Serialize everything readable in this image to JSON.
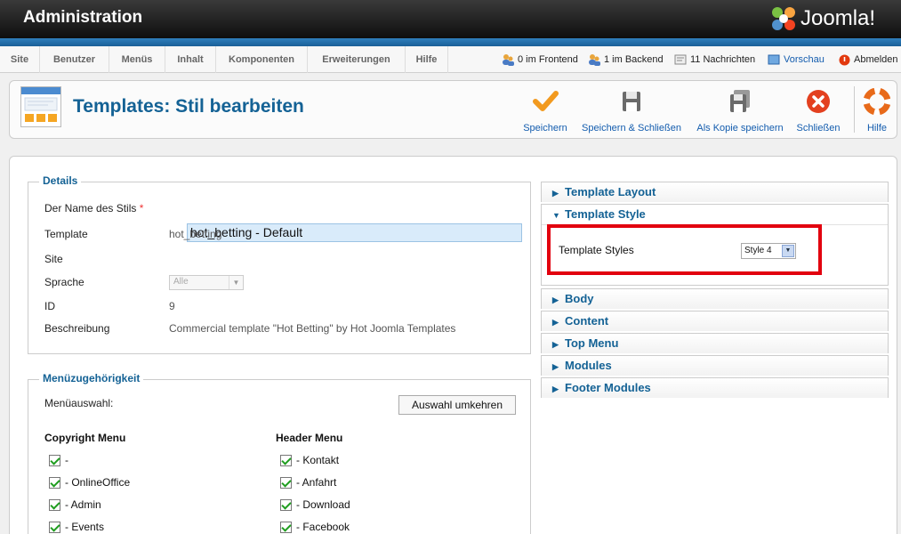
{
  "header": {
    "title": "Administration",
    "logo_text": "Joomla!"
  },
  "menu": {
    "items": [
      "Site",
      "Benutzer",
      "Menüs",
      "Inhalt",
      "Komponenten",
      "Erweiterungen",
      "Hilfe"
    ]
  },
  "status": {
    "frontend": "0 im Frontend",
    "backend": "1 im Backend",
    "messages": "11 Nachrichten",
    "preview": "Vorschau",
    "logout": "Abmelden"
  },
  "toolbar": {
    "title": "Templates: Stil bearbeiten",
    "save": "Speichern",
    "save_close": "Speichern & Schließen",
    "save_copy": "Als Kopie speichern",
    "close": "Schließen",
    "help": "Hilfe"
  },
  "details": {
    "legend": "Details",
    "name_label": "Der Name des Stils",
    "required_mark": "*",
    "name_value": "hot_betting - Default",
    "template_label": "Template",
    "template_value": "hot_betting",
    "site_label": "Site",
    "language_label": "Sprache",
    "language_value": "Alle",
    "id_label": "ID",
    "id_value": "9",
    "description_label": "Beschreibung",
    "description_value": "Commercial template \"Hot Betting\" by Hot Joomla Templates"
  },
  "menu_assignment": {
    "legend": "Menüzugehörigkeit",
    "selection_label": "Menüauswahl:",
    "invert_button": "Auswahl umkehren",
    "columns": [
      {
        "title": "Copyright Menu",
        "items": [
          "-",
          "- OnlineOffice",
          "- Admin",
          "- Events"
        ]
      },
      {
        "title": "Header Menu",
        "items": [
          "- Kontakt",
          "- Anfahrt",
          "- Download",
          "- Facebook"
        ]
      }
    ]
  },
  "panels": {
    "template_layout": "Template Layout",
    "template_style": "Template Style",
    "template_styles_label": "Template Styles",
    "template_styles_value": "Style 4",
    "body": "Body",
    "content": "Content",
    "top_menu": "Top Menu",
    "modules": "Modules",
    "footer_modules": "Footer Modules"
  },
  "colors": {
    "accent": "#146295",
    "highlight": "#e2000e",
    "header_blue": "#1a5f97",
    "check": "#1f9d1f"
  }
}
